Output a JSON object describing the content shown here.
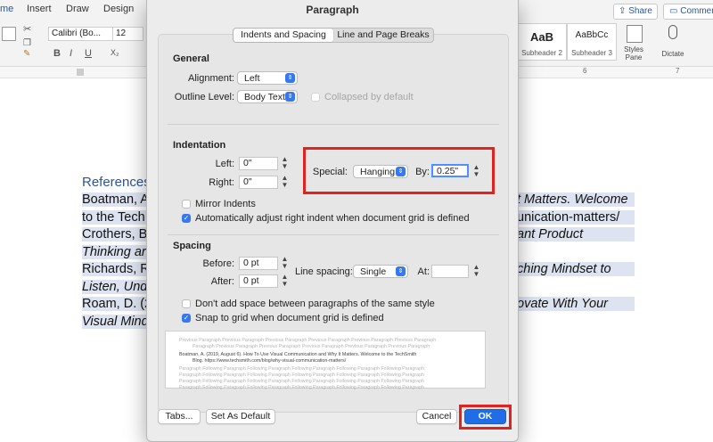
{
  "ribbon": {
    "tabs": [
      "me",
      "Insert",
      "Draw",
      "Design"
    ],
    "font_name": "Calibri (Bo...",
    "font_size": "12",
    "format_buttons": [
      "B",
      "I",
      "U",
      "X₂"
    ],
    "styles": [
      {
        "sample": "AaB",
        "name": "Subheader 2"
      },
      {
        "sample": "AaBbCc",
        "name": "Subheader 3"
      }
    ],
    "styles_pane": "Styles\nPane",
    "dictate": "Dictate",
    "share": "Share",
    "comments": "Commen",
    "ruler_marks": [
      "6",
      "7"
    ]
  },
  "document": {
    "heading": "References",
    "lines": [
      {
        "left": "Boatman, A",
        "right": "t Matters. Welcome"
      },
      {
        "left": "to the Tech",
        "right": "unication-matters/"
      },
      {
        "left": "Crothers, B",
        "right": "ant Product"
      },
      {
        "left": "Thinking ar",
        "right": ""
      },
      {
        "left": "Richards, R",
        "right": "ching Mindset to"
      },
      {
        "left": "Listen, Und",
        "right": ""
      },
      {
        "left": "Roam, D. (2",
        "right": "ovate With Your"
      },
      {
        "left": "Visual Mind",
        "right": ""
      }
    ]
  },
  "dialog": {
    "title": "Paragraph",
    "tabs": [
      "Indents and Spacing",
      "Line and Page Breaks"
    ],
    "general": {
      "heading": "General",
      "alignment_label": "Alignment:",
      "alignment_value": "Left",
      "outline_label": "Outline Level:",
      "outline_value": "Body Text",
      "collapsed_label": "Collapsed by default"
    },
    "indentation": {
      "heading": "Indentation",
      "left_label": "Left:",
      "left_value": "0\"",
      "right_label": "Right:",
      "right_value": "0\"",
      "special_label": "Special:",
      "special_value": "Hanging",
      "by_label": "By:",
      "by_value": "0.25\"",
      "mirror_label": "Mirror Indents",
      "auto_label": "Automatically adjust right indent when document grid is defined"
    },
    "spacing": {
      "heading": "Spacing",
      "before_label": "Before:",
      "before_value": "0 pt",
      "after_label": "After:",
      "after_value": "0 pt",
      "line_spacing_label": "Line spacing:",
      "line_spacing_value": "Single",
      "at_label": "At:",
      "at_value": "",
      "no_space_label": "Don't add space between paragraphs of the same style",
      "snap_label": "Snap to grid when document grid is defined"
    },
    "preview": [
      "Previous Paragraph Previous Paragraph Previous Paragraph Previous Paragraph Previous Paragraph Previous Paragraph",
      "Paragraph Previous Paragraph Previous Paragraph Previous Paragraph Previous Paragraph Previous Paragraph",
      "Boatman, A. (2019, August 6). How To Use Visual Communication and Why It Matters. Welcome to the TechSmith",
      "Blog. https://www.techsmith.com/blog/why-visual-communication-matters/",
      "Paragraph Following Paragraph Following Paragraph Following Paragraph Following Paragraph Following Paragraph",
      "Paragraph Following Paragraph Following Paragraph Following Paragraph Following Paragraph Following Paragraph",
      "Paragraph Following Paragraph Following Paragraph Following Paragraph Following Paragraph Following Paragraph",
      "Paragraph Following Paragraph Following Paragraph Following Paragraph Following Paragraph Following Paragraph"
    ],
    "buttons": {
      "tabs": "Tabs...",
      "default": "Set As Default",
      "cancel": "Cancel",
      "ok": "OK"
    }
  },
  "colors": {
    "accent": "#1f6ee8",
    "highlight_box": "#e0231e",
    "selection": "#dde3f0",
    "heading": "#2f5496"
  }
}
